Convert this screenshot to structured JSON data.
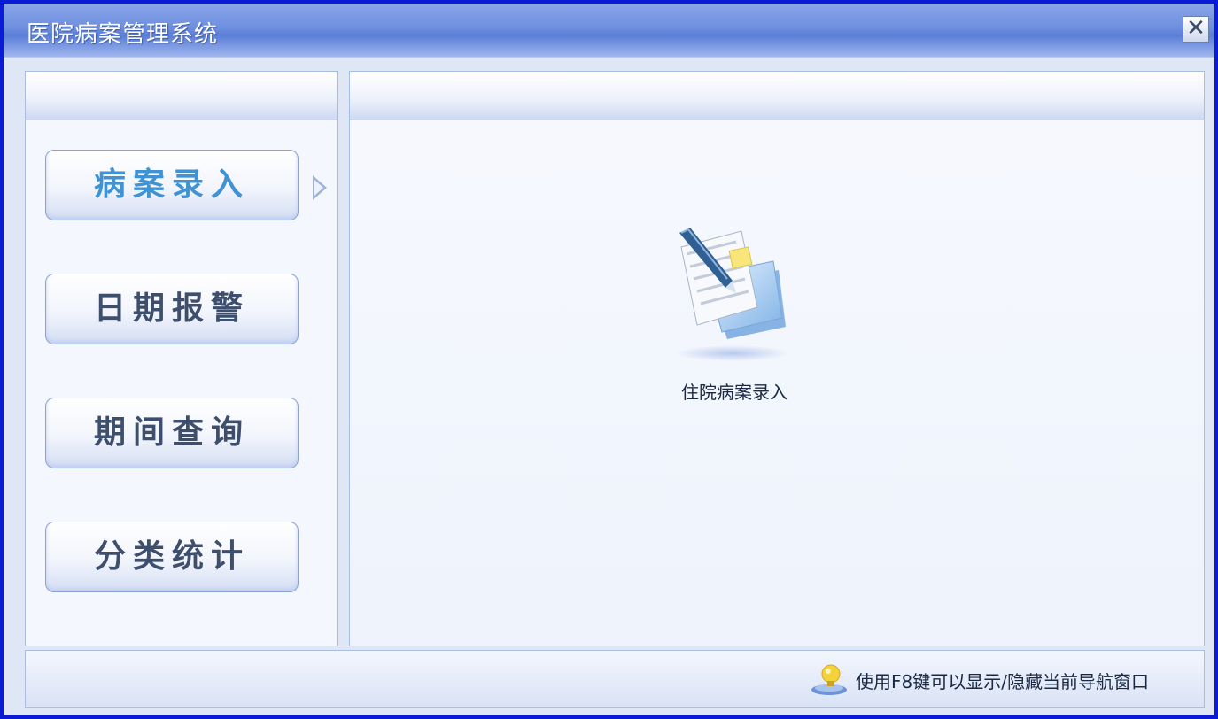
{
  "window": {
    "title": "医院病案管理系统",
    "close_label": "✕"
  },
  "nav": {
    "items": [
      {
        "label": "病案录入",
        "active": true
      },
      {
        "label": "日期报警",
        "active": false
      },
      {
        "label": "期间查询",
        "active": false
      },
      {
        "label": "分类统计",
        "active": false
      }
    ]
  },
  "main": {
    "launch_item": {
      "label": "住院病案录入",
      "icon": "medical-record-entry-icon"
    }
  },
  "statusbar": {
    "hint": "使用F8键可以显示/隐藏当前导航窗口",
    "icon": "lightbulb-icon"
  },
  "colors": {
    "window_border": "#0a1bd8",
    "title_bar": "#6f8fe0",
    "active_nav_text": "#3f93d4",
    "nav_text": "#3e4f6e"
  }
}
